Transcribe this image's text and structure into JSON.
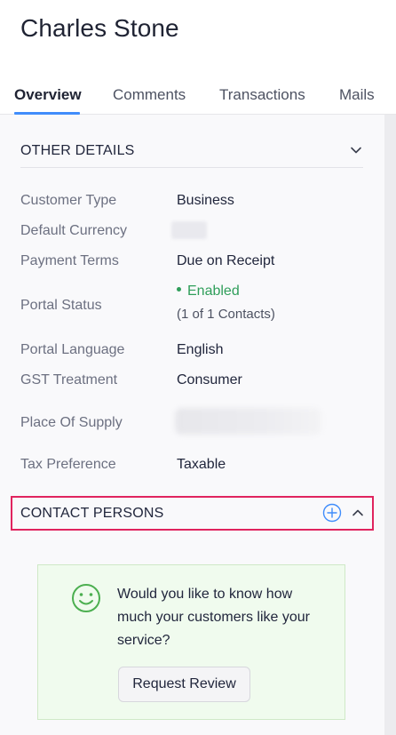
{
  "header": {
    "title": "Charles Stone"
  },
  "tabs": [
    {
      "label": "Overview",
      "active": true
    },
    {
      "label": "Comments"
    },
    {
      "label": "Transactions"
    },
    {
      "label": "Mails"
    }
  ],
  "other_details": {
    "title": "OTHER DETAILS",
    "rows": [
      {
        "label": "Customer Type",
        "value": "Business"
      },
      {
        "label": "Default Currency",
        "value": ""
      },
      {
        "label": "Payment Terms",
        "value": "Due on Receipt"
      },
      {
        "label": "Portal Status",
        "value": "Enabled",
        "sub": "(1 of 1 Contacts)"
      },
      {
        "label": "Portal Language",
        "value": "English"
      },
      {
        "label": "GST Treatment",
        "value": "Consumer"
      },
      {
        "label": "Place Of Supply",
        "value": ""
      },
      {
        "label": "Tax Preference",
        "value": "Taxable"
      }
    ]
  },
  "contact_persons": {
    "title": "CONTACT PERSONS"
  },
  "review": {
    "text": "Would you like to know how much your customers like your service?",
    "button": "Request Review"
  },
  "colors": {
    "accent": "#408dfb",
    "enabled": "#2f9e5a",
    "highlight_border": "#e0245e",
    "review_bg": "#f0fbee"
  }
}
